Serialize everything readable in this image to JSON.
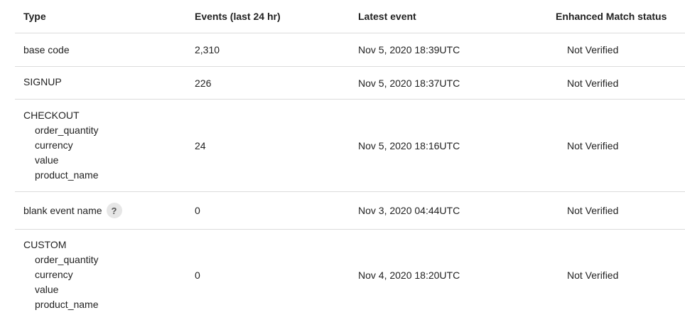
{
  "table": {
    "headers": {
      "type": "Type",
      "events": "Events (last 24 hr)",
      "latest": "Latest event",
      "status": "Enhanced Match status"
    },
    "rows": [
      {
        "type": "base code",
        "params": [],
        "events": "2,310",
        "latest": "Nov 5, 2020 18:39UTC",
        "status": "Not Verified"
      },
      {
        "type": "SIGNUP",
        "params": [],
        "events": "226",
        "latest": "Nov 5, 2020 18:37UTC",
        "status": "Not Verified"
      },
      {
        "type": "CHECKOUT",
        "params": [
          "order_quantity",
          "currency",
          "value",
          "product_name"
        ],
        "events": "24",
        "latest": "Nov 5, 2020 18:16UTC",
        "status": "Not Verified"
      },
      {
        "type": "blank event name",
        "help_icon": "?",
        "params": [],
        "events": "0",
        "latest": "Nov 3, 2020 04:44UTC",
        "status": "Not Verified"
      },
      {
        "type": "CUSTOM",
        "params": [
          "order_quantity",
          "currency",
          "value",
          "product_name"
        ],
        "events": "0",
        "latest": "Nov 4, 2020 18:20UTC",
        "status": "Not Verified"
      }
    ]
  },
  "icons": {
    "help": "question-mark-icon"
  }
}
